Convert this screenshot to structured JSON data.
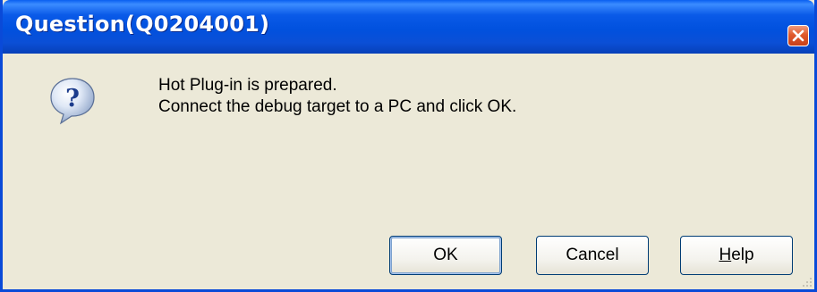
{
  "window": {
    "title": "Question(Q0204001)",
    "close_icon": "close-icon"
  },
  "dialog": {
    "icon": "question-icon",
    "message_lines": [
      "Hot Plug-in is prepared.",
      "Connect the debug target to a PC and click OK."
    ]
  },
  "buttons": {
    "ok_label": "OK",
    "cancel_label": "Cancel",
    "help_label_first": "H",
    "help_label_rest": "elp"
  },
  "colors": {
    "titlebar": "#0151de",
    "body": "#ece9d8",
    "close": "#e05a2c"
  }
}
